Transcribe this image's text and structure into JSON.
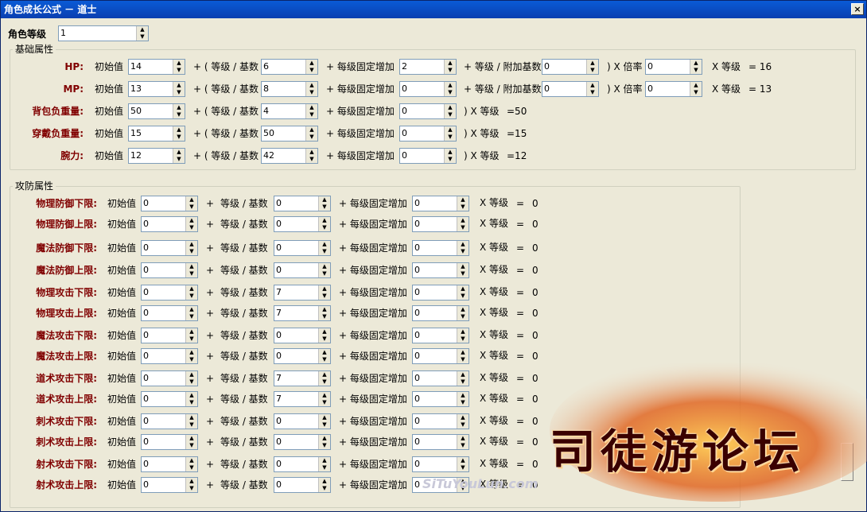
{
  "title": "角色成长公式 － 道士",
  "close_label": "×",
  "level": {
    "label": "角色等级",
    "value": "1"
  },
  "basic": {
    "legend": "基础属性",
    "rows": [
      {
        "name": "HP:",
        "init": "14",
        "base": "6",
        "fixed": "2",
        "extra": "0",
        "rate": "0",
        "result": "= 16"
      },
      {
        "name": "MP:",
        "init": "13",
        "base": "8",
        "fixed": "0",
        "extra": "0",
        "rate": "0",
        "result": "= 13"
      },
      {
        "name": "背包负重量:",
        "init": "50",
        "base": "4",
        "fixed": "0",
        "result": "=50"
      },
      {
        "name": "穿戴负重量:",
        "init": "15",
        "base": "50",
        "fixed": "0",
        "result": "=15"
      },
      {
        "name": "腕力:",
        "init": "12",
        "base": "42",
        "fixed": "0",
        "result": "=12"
      }
    ],
    "t_init": "初始值",
    "t_lvbase": "+ ( 等级 / 基数",
    "t_fixed": "+ 每级固定增加",
    "t_extra": "+ 等级 / 附加基数",
    "t_rate": ") X 倍率",
    "t_xlv": "X 等级",
    "t_closexlv": ") X 等级"
  },
  "combat": {
    "legend": "攻防属性",
    "rows": [
      {
        "name": "物理防御下限:",
        "init": "0",
        "base": "0",
        "fixed": "0",
        "result": "0"
      },
      {
        "name": "物理防御上限:",
        "init": "0",
        "base": "0",
        "fixed": "0",
        "result": "0"
      },
      {
        "name": "魔法防御下限:",
        "init": "0",
        "base": "0",
        "fixed": "0",
        "result": "0"
      },
      {
        "name": "魔法防御上限:",
        "init": "0",
        "base": "0",
        "fixed": "0",
        "result": "0"
      },
      {
        "name": "物理攻击下限:",
        "init": "0",
        "base": "7",
        "fixed": "0",
        "result": "0"
      },
      {
        "name": "物理攻击上限:",
        "init": "0",
        "base": "7",
        "fixed": "0",
        "result": "0"
      },
      {
        "name": "魔法攻击下限:",
        "init": "0",
        "base": "0",
        "fixed": "0",
        "result": "0"
      },
      {
        "name": "魔法攻击上限:",
        "init": "0",
        "base": "0",
        "fixed": "0",
        "result": "0"
      },
      {
        "name": "道术攻击下限:",
        "init": "0",
        "base": "7",
        "fixed": "0",
        "result": "0"
      },
      {
        "name": "道术攻击上限:",
        "init": "0",
        "base": "7",
        "fixed": "0",
        "result": "0"
      },
      {
        "name": "刺术攻击下限:",
        "init": "0",
        "base": "0",
        "fixed": "0",
        "result": "0"
      },
      {
        "name": "刺术攻击上限:",
        "init": "0",
        "base": "0",
        "fixed": "0",
        "result": "0"
      },
      {
        "name": "射术攻击下限:",
        "init": "0",
        "base": "0",
        "fixed": "0",
        "result": "0"
      },
      {
        "name": "射术攻击上限:",
        "init": "0",
        "base": "0",
        "fixed": "0",
        "result": "0"
      }
    ],
    "t_init": "初始值",
    "t_plus": "+",
    "t_lvbase": "等级 / 基数",
    "t_fixed": "+ 每级固定增加",
    "t_xlv": "X 等级",
    "t_eq": "="
  },
  "watermark": {
    "text": "司徒游论坛",
    "sub": "SiTuYouLun.com"
  },
  "colors": {
    "row_label": "#800000",
    "titlebar": "#0a3fb0",
    "face": "#ece9d8"
  }
}
